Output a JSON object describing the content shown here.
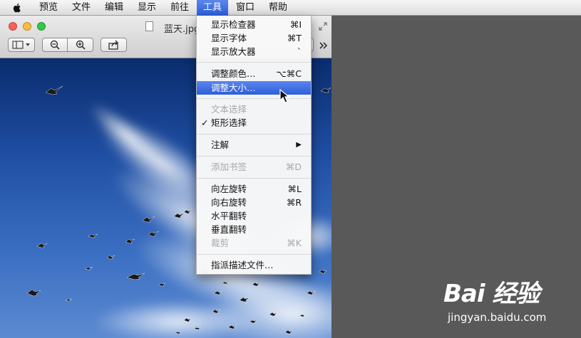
{
  "menubar": {
    "items": [
      "预览",
      "文件",
      "编辑",
      "显示",
      "前往",
      "工具",
      "窗口",
      "帮助"
    ],
    "active_index": 5,
    "active_color": "#3a6ae0"
  },
  "window": {
    "title": "蓝天.jpg",
    "traffic_light_colors": [
      "#fc605c",
      "#fdbc40",
      "#34c84a"
    ],
    "toolbar_icons": [
      "sidebar-icon",
      "zoom-out-icon",
      "zoom-in-icon",
      "share-icon",
      "more-icon"
    ]
  },
  "menu": {
    "items": [
      {
        "label": "显示检查器",
        "shortcut": "⌘I",
        "enabled": true
      },
      {
        "label": "显示字体",
        "shortcut": "⌘T",
        "enabled": true
      },
      {
        "label": "显示放大器",
        "shortcut": "`",
        "enabled": true
      },
      {
        "label": "调整颜色…",
        "shortcut": "⌥⌘C",
        "enabled": true
      },
      {
        "label": "调整大小…",
        "shortcut": "",
        "enabled": true,
        "highlighted": true
      },
      {
        "label": "文本选择",
        "shortcut": "",
        "enabled": false
      },
      {
        "label": "矩形选择",
        "shortcut": "",
        "enabled": true,
        "checked": true
      },
      {
        "label": "注解",
        "shortcut": "▶",
        "enabled": true
      },
      {
        "label": "添加书签",
        "shortcut": "⌘D",
        "enabled": false
      },
      {
        "label": "向左旋转",
        "shortcut": "⌘L",
        "enabled": true
      },
      {
        "label": "向右旋转",
        "shortcut": "⌘R",
        "enabled": true
      },
      {
        "label": "水平翻转",
        "shortcut": "",
        "enabled": true
      },
      {
        "label": "垂直翻转",
        "shortcut": "",
        "enabled": true
      },
      {
        "label": "裁剪",
        "shortcut": "⌘K",
        "enabled": false
      },
      {
        "label": "指派描述文件…",
        "shortcut": "",
        "enabled": true
      }
    ],
    "checkmark": "✓",
    "highlight_color": "#3a6ae0"
  },
  "watermark": {
    "logo": "Bai 经验",
    "sub": "jingyan.baidu.com"
  }
}
